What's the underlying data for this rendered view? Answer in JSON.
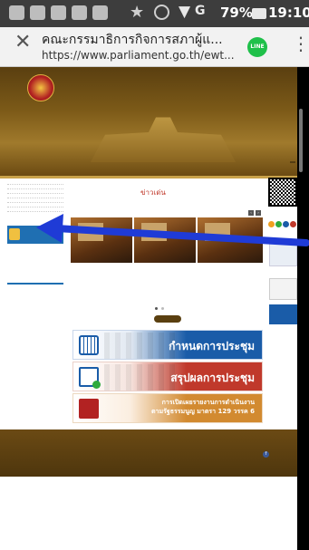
{
  "status_bar": {
    "battery_percent": "79%",
    "time": "19:10"
  },
  "browser": {
    "tab_title": "คณะกรรมาธิการกิจการสภาผู้แ...",
    "url": "https://www.parliament.go.th/ewt...",
    "line_badge": "LINE"
  },
  "colors": {
    "header_gold": "#7c5a18",
    "accent_red": "#c0392b",
    "accent_blue": "#1a5ca8",
    "arrow_blue": "#1f3bd6"
  },
  "site": {
    "news_title": "ข่าวเด่น"
  },
  "banners": {
    "meeting_schedule": "กำหนดการประชุม",
    "meeting_summary": "สรุปผลการประชุม",
    "report_line1": "การเปิดเผยรายงานการดำเนินงาน",
    "report_line2": "ตามรัฐธรรมนูญ มาตรา 129 วรรค 6"
  },
  "icons": {
    "close": "close-icon",
    "menu": "kebab-menu-icon",
    "line": "line-app-icon",
    "facebook": "facebook-icon"
  }
}
